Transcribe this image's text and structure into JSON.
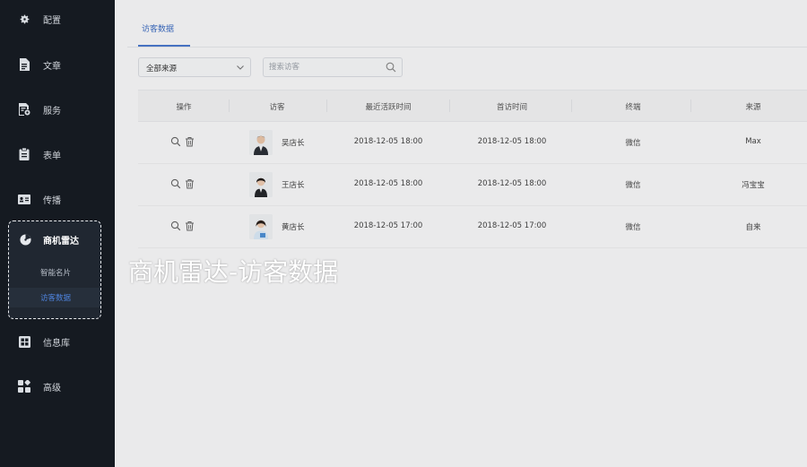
{
  "sidebar": {
    "items": [
      {
        "label": "配置",
        "icon": "gear-icon"
      },
      {
        "label": "文章",
        "icon": "document-icon"
      },
      {
        "label": "服务",
        "icon": "service-icon"
      },
      {
        "label": "表单",
        "icon": "clipboard-icon"
      },
      {
        "label": "传播",
        "icon": "id-card-icon"
      }
    ],
    "radar": {
      "label": "商机雷达",
      "icon": "radar-icon",
      "sub_items": [
        {
          "label": "智能名片"
        },
        {
          "label": "访客数据",
          "active": true
        }
      ]
    },
    "items_bottom": [
      {
        "label": "信息库",
        "icon": "grid-icon"
      },
      {
        "label": "高级",
        "icon": "apps-icon"
      }
    ]
  },
  "main": {
    "tab": "访客数据",
    "filter": {
      "source_select": "全部来源",
      "search_placeholder": "搜索访客"
    },
    "table": {
      "columns": [
        "操作",
        "访客",
        "最近活跃时间",
        "首访时间",
        "终端",
        "来源"
      ],
      "rows": [
        {
          "visitor": "吴店长",
          "last_active": "2018-12-05 18:00",
          "first_visit": "2018-12-05 18:00",
          "terminal": "微信",
          "source": "Max"
        },
        {
          "visitor": "王店长",
          "last_active": "2018-12-05 18:00",
          "first_visit": "2018-12-05 18:00",
          "terminal": "微信",
          "source": "冯宝宝"
        },
        {
          "visitor": "黄店长",
          "last_active": "2018-12-05 17:00",
          "first_visit": "2018-12-05 17:00",
          "terminal": "微信",
          "source": "自来"
        }
      ]
    }
  },
  "caption": "商机雷达-访客数据",
  "colors": {
    "sidebar_bg": "#151a21",
    "accent": "#4a78cc",
    "caption": "#ffffff"
  }
}
